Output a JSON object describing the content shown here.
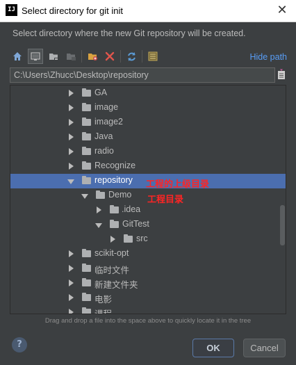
{
  "window": {
    "app_icon": "IJ",
    "title": "Select directory for git init",
    "close_glyph": "✕"
  },
  "description": "Select directory where the new Git repository will be created.",
  "toolbar": {
    "buttons": [
      {
        "icon": "home-icon"
      },
      {
        "icon": "desktop-icon"
      },
      {
        "icon": "project-folder-icon"
      },
      {
        "icon": "module-folder-icon"
      },
      {
        "icon": "new-folder-icon"
      },
      {
        "icon": "delete-icon"
      },
      {
        "icon": "refresh-icon"
      },
      {
        "icon": "show-hidden-icon"
      }
    ],
    "hide_path_label": "Hide path"
  },
  "path_field": {
    "value": "C:\\Users\\Zhucc\\Desktop\\repository"
  },
  "tree": {
    "rows": [
      {
        "label": "GA"
      },
      {
        "label": "image"
      },
      {
        "label": "image2"
      },
      {
        "label": "Java"
      },
      {
        "label": "radio"
      },
      {
        "label": "Recognize"
      },
      {
        "label": "repository"
      },
      {
        "label": "Demo"
      },
      {
        "label": ".idea"
      },
      {
        "label": "GitTest"
      },
      {
        "label": "src"
      },
      {
        "label": "scikit-opt"
      },
      {
        "label": "临时文件"
      },
      {
        "label": "新建文件夹"
      },
      {
        "label": "电影"
      },
      {
        "label": "课程"
      }
    ],
    "annotations": {
      "parent_dir": "工程的上级目录",
      "project_dir": "工程目录"
    }
  },
  "hint": "Drag and drop a file into the space above to quickly locate it in the tree",
  "footer": {
    "help_glyph": "?",
    "ok_label": "OK",
    "cancel_label": "Cancel"
  },
  "colors": {
    "background": "#3c3f41",
    "selection": "#4b6eaf",
    "link": "#589df6",
    "annotation": "#ff2424"
  }
}
